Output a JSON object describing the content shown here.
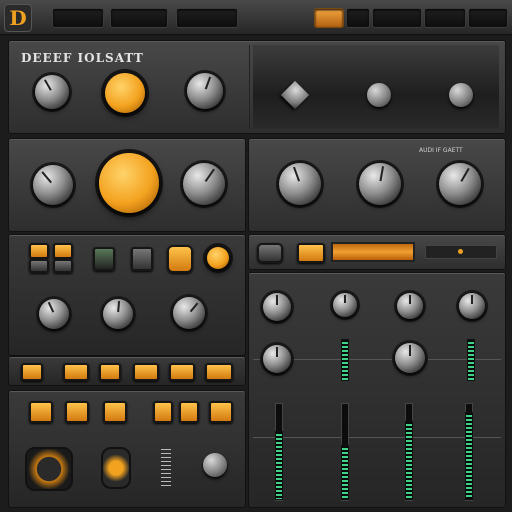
{
  "app": {
    "logo_letter": "D",
    "title": "DEEEF IOLSATT"
  },
  "top_bar": {
    "slots": [
      "",
      "",
      "",
      "",
      "",
      "",
      "",
      "",
      ""
    ]
  },
  "section1": {
    "left_labels": [
      "",
      "",
      ""
    ],
    "right_labels": []
  },
  "section2": {
    "left_labels": [
      "",
      "",
      ""
    ],
    "right_header": "AUDI IF GAETT",
    "right_labels": [
      "",
      "",
      "",
      "",
      "",
      "",
      "",
      "",
      "",
      "",
      "",
      "",
      "",
      "",
      ""
    ]
  },
  "section3": {
    "labels": [
      "",
      "",
      "",
      "",
      "",
      ""
    ]
  },
  "section4": {
    "labels": [
      "",
      "",
      "",
      "",
      "",
      ""
    ]
  },
  "mixer": {
    "readout_value": 0.5,
    "channel_labels": [
      "",
      "",
      "",
      ""
    ],
    "meter_levels": [
      0.7,
      0.55,
      0.8,
      0.9
    ]
  },
  "colors": {
    "accent": "#f3a21f",
    "meter": "#3fd38a",
    "panel": "#3a3a3a"
  }
}
